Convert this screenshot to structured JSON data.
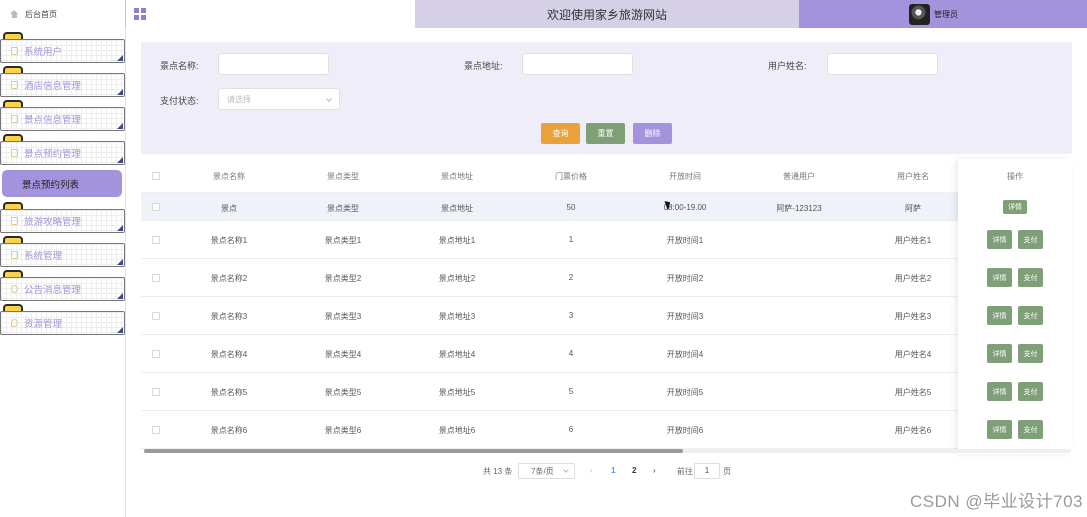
{
  "header": {
    "home_label": "后台首页",
    "site_title": "欢迎使用家乡旅游网站",
    "user_name": "管理员"
  },
  "sidebar": {
    "items": [
      {
        "label": "系统用户",
        "icon": "user-icon"
      },
      {
        "label": "酒店信息管理",
        "icon": "doc-icon"
      },
      {
        "label": "景点信息管理",
        "icon": "doc-icon"
      },
      {
        "label": "景点预约管理",
        "icon": "doc-icon"
      },
      {
        "label": "景点预约列表",
        "active": true
      },
      {
        "label": "旅游攻略管理",
        "icon": "doc-icon"
      },
      {
        "label": "系统管理",
        "icon": "doc-icon"
      },
      {
        "label": "公告消息管理",
        "icon": "clock-icon"
      },
      {
        "label": "资源管理",
        "icon": "pin-icon"
      }
    ]
  },
  "search": {
    "name_label": "景点名称:",
    "address_label": "景点地址:",
    "username_label": "用户姓名:",
    "pay_label": "支付状态:",
    "pay_placeholder": "请选择",
    "query_btn": "查询",
    "reset_btn": "重置",
    "delete_btn": "删除"
  },
  "table": {
    "columns": [
      "景点名称",
      "景点类型",
      "景点地址",
      "门票价格",
      "开放时间",
      "普通用户",
      "用户姓名",
      "操作"
    ],
    "rows": [
      {
        "name": "景点",
        "type": "景点类型",
        "address": "景点地址",
        "price": "50",
        "open": "08:00-19.00",
        "user": "阿萨-123123",
        "username": "阿萨",
        "actions": [
          "详情"
        ]
      },
      {
        "name": "景点名称1",
        "type": "景点类型1",
        "address": "景点地址1",
        "price": "1",
        "open": "开放时间1",
        "user": "",
        "username": "用户姓名1",
        "actions": [
          "详情",
          "支付"
        ]
      },
      {
        "name": "景点名称2",
        "type": "景点类型2",
        "address": "景点地址2",
        "price": "2",
        "open": "开放时间2",
        "user": "",
        "username": "用户姓名2",
        "actions": [
          "详情",
          "支付"
        ]
      },
      {
        "name": "景点名称3",
        "type": "景点类型3",
        "address": "景点地址3",
        "price": "3",
        "open": "开放时间3",
        "user": "",
        "username": "用户姓名3",
        "actions": [
          "详情",
          "支付"
        ]
      },
      {
        "name": "景点名称4",
        "type": "景点类型4",
        "address": "景点地址4",
        "price": "4",
        "open": "开放时间4",
        "user": "",
        "username": "用户姓名4",
        "actions": [
          "详情",
          "支付"
        ]
      },
      {
        "name": "景点名称5",
        "type": "景点类型5",
        "address": "景点地址5",
        "price": "5",
        "open": "开放时间5",
        "user": "",
        "username": "用户姓名5",
        "actions": [
          "详情",
          "支付"
        ]
      },
      {
        "name": "景点名称6",
        "type": "景点类型6",
        "address": "景点地址6",
        "price": "6",
        "open": "开放时间6",
        "user": "",
        "username": "用户姓名6",
        "actions": [
          "详情",
          "支付"
        ]
      }
    ]
  },
  "pagination": {
    "total": "共 13 条",
    "page_size": "7条/页",
    "pages": [
      "1",
      "2"
    ],
    "current": "1",
    "goto_label": "前往",
    "goto_value": "1",
    "page_unit": "页"
  },
  "watermark": "CSDN @毕业设计703",
  "colors": {
    "accent": "#a393dc",
    "search_bg": "#efedf8",
    "query": "#e9a23b",
    "reset": "#7e9f78",
    "delete": "#a393dc",
    "action": "#7e9f78"
  }
}
